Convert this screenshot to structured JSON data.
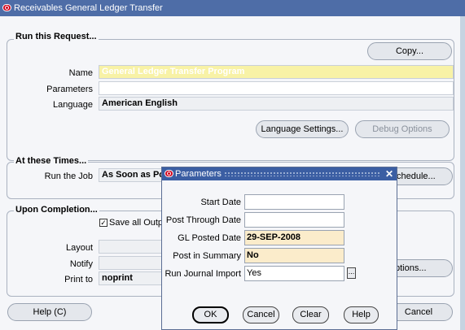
{
  "window": {
    "title": "Receivables General Ledger Transfer"
  },
  "run_request": {
    "group_title": "Run this Request...",
    "copy_label": "Copy...",
    "name_label": "Name",
    "name_value": "General Ledger Transfer Program",
    "parameters_label": "Parameters",
    "parameters_value": "",
    "language_label": "Language",
    "language_value": "American English",
    "language_settings_label": "Language Settings...",
    "debug_options_label": "Debug Options"
  },
  "times": {
    "group_title": "At these Times...",
    "run_job_label": "Run the Job",
    "run_job_value": "As Soon as Po",
    "schedule_label": "chedule..."
  },
  "completion": {
    "group_title": "Upon Completion...",
    "save_all_label": "Save all Outp",
    "save_all_checked": "✓",
    "layout_label": "Layout",
    "notify_label": "Notify",
    "print_to_label": "Print to",
    "print_to_value": "noprint",
    "options_label": "ptions..."
  },
  "footer": {
    "help_label": "Help (C)",
    "cancel_label": "Cancel"
  },
  "dialog": {
    "title": "Parameters",
    "fields": [
      {
        "label": "Start Date",
        "value": ""
      },
      {
        "label": "Post Through Date",
        "value": ""
      },
      {
        "label": "GL Posted Date",
        "value": "29-SEP-2008"
      },
      {
        "label": "Post in Summary",
        "value": "No"
      },
      {
        "label": "Run Journal Import",
        "value": "Yes"
      }
    ],
    "lov_label": "...",
    "buttons": {
      "ok": "OK",
      "cancel": "Cancel",
      "clear": "Clear",
      "help": "Help"
    }
  },
  "colors": {
    "title_bar": "#4e6da7",
    "dialog_title_bar": "#3b5ea3",
    "highlight_field": "#f8f2a6",
    "tan_field": "#fbeccb",
    "window_bg": "#f5f6f9"
  }
}
